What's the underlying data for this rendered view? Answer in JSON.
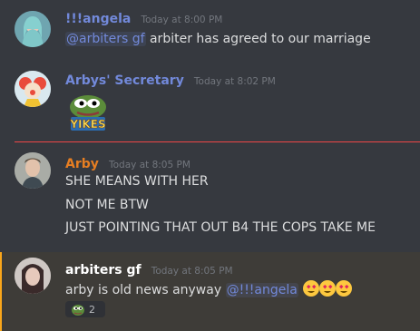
{
  "messages": [
    {
      "username": "!!!angela",
      "username_color": "#7289da",
      "timestamp": "Today at 8:00 PM",
      "mention": "@arbiters gf",
      "text": " arbiter has agreed to our marriage"
    },
    {
      "username": "Arbys' Secretary",
      "username_color": "#7289da",
      "timestamp": "Today at 8:02 PM",
      "emoji_text": "YIKES",
      "emoji_name": "pepe-yikes"
    },
    {
      "username": "Arby",
      "username_color": "#e67e22",
      "timestamp": "Today at 8:05 PM",
      "lines": [
        "SHE MEANS WITH HER",
        "NOT ME BTW",
        "JUST POINTING THAT OUT B4 THE COPS TAKE ME"
      ]
    },
    {
      "username": "arbiters gf",
      "username_color": "#ffffff",
      "timestamp": "Today at 8:05 PM",
      "text": "arby is old news anyway ",
      "mention": "@!!!angela",
      "trailing_emoji": "heart-eyes",
      "reaction": {
        "emoji": "pepe",
        "count": "2"
      }
    }
  ],
  "colors": {
    "background": "#36393f",
    "new_messages_divider": "#f04747",
    "mention_highlight_border": "#faa61a"
  }
}
